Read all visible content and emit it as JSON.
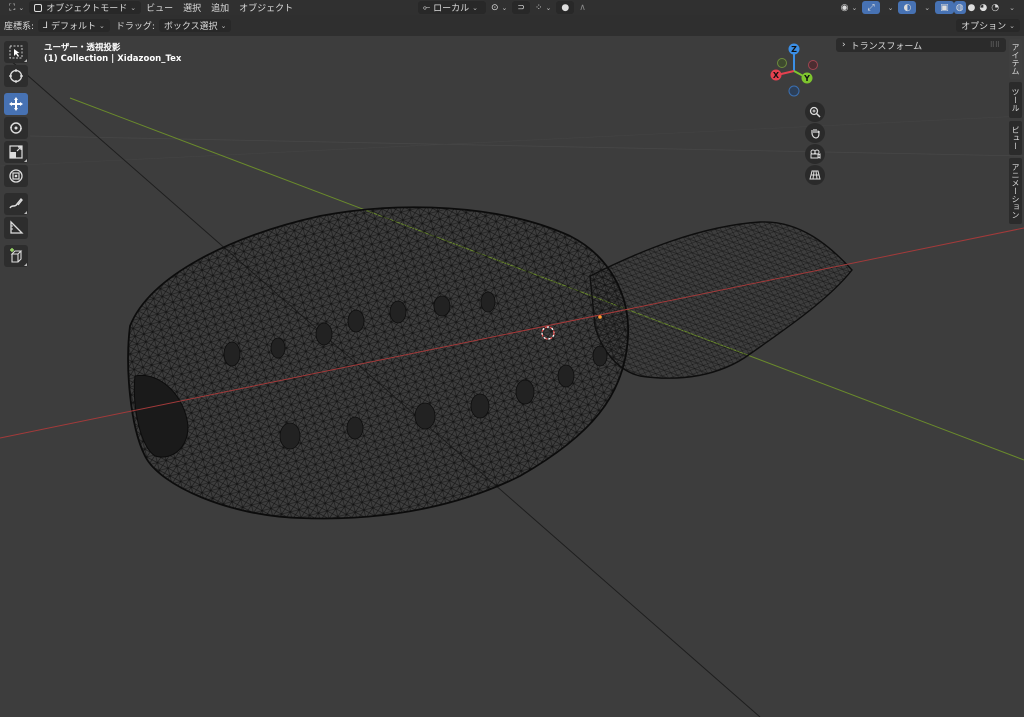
{
  "header": {
    "editor_icon": "view3d-editor-icon",
    "mode": "オブジェクトモード",
    "menus": [
      "ビュー",
      "選択",
      "追加",
      "オブジェクト"
    ],
    "transform_orientation": "ローカル",
    "options_label": "オプション"
  },
  "subheader": {
    "coord_label": "座標系:",
    "coord_value": "デフォルト",
    "drag_label": "ドラッグ:",
    "drag_value": "ボックス選択"
  },
  "viewport": {
    "view_name": "ユーザー・透視投影",
    "collection_line": "(1) Collection | Xidazoon_Tex"
  },
  "gizmo": {
    "x_label": "X",
    "y_label": "Y",
    "z_label": "Z",
    "colors": {
      "x": "#e5414f",
      "y": "#7ec52e",
      "z": "#3b8fe6"
    }
  },
  "tools": [
    "select-box-icon",
    "cursor-icon",
    "move-icon",
    "rotate-icon",
    "scale-icon",
    "transform-icon",
    "annotate-icon",
    "measure-icon",
    "add-cube-icon"
  ],
  "nav_buttons": [
    "zoom-icon",
    "pan-hand-icon",
    "camera-icon",
    "grid-perspective-icon"
  ],
  "npanel": {
    "section_title": "トランスフォーム",
    "tabs": [
      "アイテム",
      "ツール",
      "ビュー",
      "アニメーション"
    ]
  }
}
